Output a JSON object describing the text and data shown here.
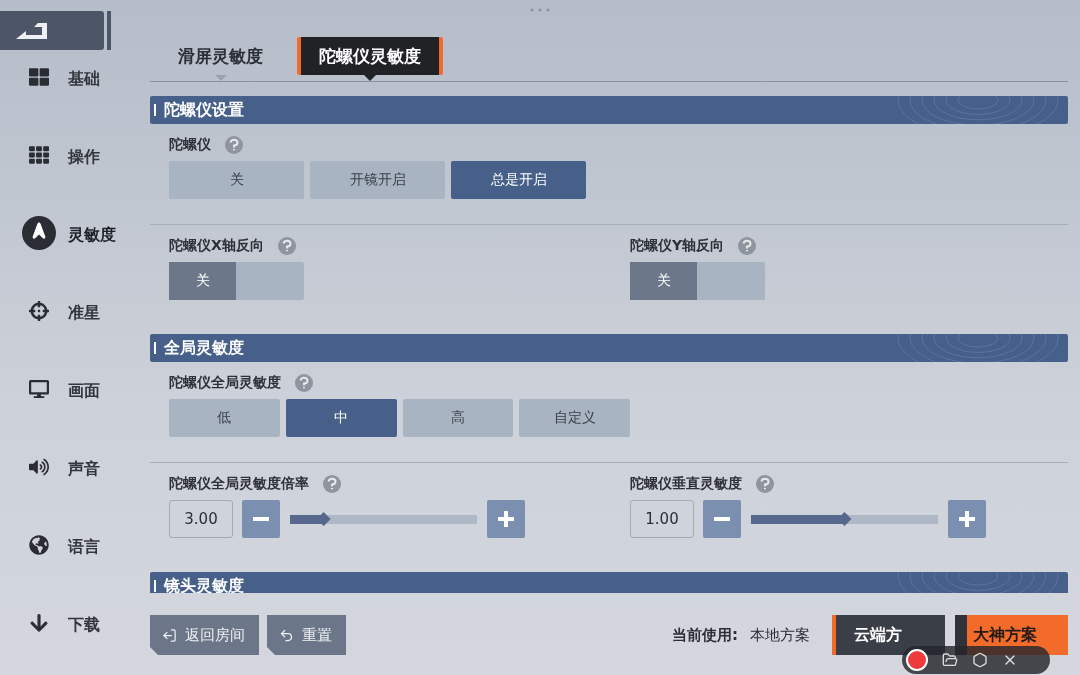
{
  "sidebar": {
    "items": [
      {
        "label": "基础",
        "kind": "grid",
        "selected": false
      },
      {
        "label": "操作",
        "kind": "keypad",
        "selected": false
      },
      {
        "label": "灵敏度",
        "kind": "cursor",
        "selected": true
      },
      {
        "label": "准星",
        "kind": "crosshair",
        "selected": false
      },
      {
        "label": "画面",
        "kind": "monitor",
        "selected": false
      },
      {
        "label": "声音",
        "kind": "speaker",
        "selected": false
      },
      {
        "label": "语言",
        "kind": "globe",
        "selected": false
      },
      {
        "label": "下载",
        "kind": "download",
        "selected": false
      }
    ]
  },
  "tabs": [
    {
      "label": "滑屏灵敏度",
      "selected": false
    },
    {
      "label": "陀螺仪灵敏度",
      "selected": true
    }
  ],
  "sections": [
    {
      "title": "陀螺仪设置",
      "rows": [
        [
          {
            "kind": "choice",
            "label": "陀螺仪",
            "options": [
              {
                "label": "关",
                "selected": false
              },
              {
                "label": "开镜开启",
                "selected": false
              },
              {
                "label": "总是开启",
                "selected": true
              }
            ]
          }
        ],
        [
          {
            "kind": "toggle",
            "label": "陀螺仪X轴反向",
            "on": false,
            "state_label": "关"
          },
          {
            "kind": "toggle",
            "label": "陀螺仪Y轴反向",
            "on": false,
            "state_label": "关"
          }
        ]
      ]
    },
    {
      "title": "全局灵敏度",
      "rows": [
        [
          {
            "kind": "choice",
            "label": "陀螺仪全局灵敏度",
            "options": [
              {
                "label": "低",
                "selected": false
              },
              {
                "label": "中",
                "selected": true
              },
              {
                "label": "高",
                "selected": false
              },
              {
                "label": "自定义",
                "selected": false
              }
            ]
          }
        ],
        [
          {
            "kind": "slider",
            "label": "陀螺仪全局灵敏度倍率",
            "value": "3.00",
            "level": 0.18
          },
          {
            "kind": "slider",
            "label": "陀螺仪垂直灵敏度",
            "value": "1.00",
            "level": 0.5
          }
        ]
      ]
    },
    {
      "title": "镜头灵敏度"
    }
  ],
  "footer": {
    "buttons": [
      {
        "label": "返回房间",
        "kind": "exit"
      },
      {
        "label": "重置",
        "kind": "undo"
      }
    ],
    "current_label": "当前使用:",
    "current_value": "本地方案",
    "schemes": [
      {
        "label": "云端方",
        "kind": "dark"
      },
      {
        "label": "大神方案",
        "kind": "accent"
      }
    ]
  }
}
